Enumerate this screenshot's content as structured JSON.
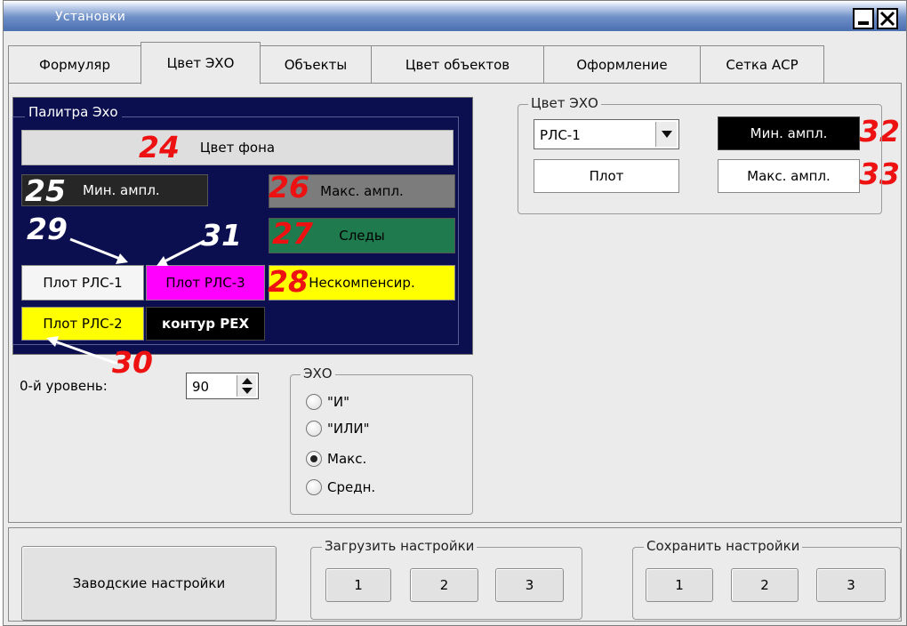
{
  "window": {
    "title": "Установки"
  },
  "tabs": [
    {
      "label": "Формуляр"
    },
    {
      "label": "Цвет ЭХО"
    },
    {
      "label": "Объекты"
    },
    {
      "label": "Цвет объектов"
    },
    {
      "label": "Оформление"
    },
    {
      "label": "Сетка АСР"
    }
  ],
  "palette": {
    "title": "Палитра Эхо",
    "background_label": "Цвет фона",
    "min_ampl_label": "Мин. ампл.",
    "max_ampl_label": "Макс. ампл.",
    "traces_label": "Следы",
    "uncompensated_label": "Нескомпенсир.",
    "plot_rls1_label": "Плот РЛС-1",
    "plot_rls3_label": "Плот РЛС-3",
    "plot_rls2_label": "Плот РЛС-2",
    "contour_label": "контур РЕХ",
    "colors": {
      "background": "#0b0e4f",
      "bg_button": "#dedede",
      "min_ampl": "#262626",
      "max_ampl": "#7c7c7c",
      "traces": "#1f7a4d",
      "uncompensated": "#ffff00",
      "plot_rls1": "#f5f5f5",
      "plot_rls3": "#ff00ff",
      "plot_rls2": "#ffff00",
      "contour": "#000000"
    }
  },
  "zero_level": {
    "label": "0-й уровень:",
    "value": "90"
  },
  "echo_mode": {
    "label": "ЭХО",
    "options": [
      {
        "label": "\"И\"",
        "checked": false
      },
      {
        "label": "\"ИЛИ\"",
        "checked": false
      },
      {
        "label": "Макс.",
        "checked": true
      },
      {
        "label": "Средн.",
        "checked": false
      }
    ]
  },
  "echo_color": {
    "label": "Цвет ЭХО",
    "radar_select": "РЛС-1",
    "min_ampl_label": "Мин. ампл.",
    "plot_label": "Плот",
    "max_ampl_label": "Макс. ампл."
  },
  "bottom": {
    "factory_label": "Заводские настройки",
    "load": {
      "label": "Загрузить настройки",
      "buttons": [
        "1",
        "2",
        "3"
      ]
    },
    "save": {
      "label": "Сохранить настройки",
      "buttons": [
        "1",
        "2",
        "3"
      ]
    }
  },
  "annotations": {
    "n24": "24",
    "n25": "25",
    "n26": "26",
    "n27": "27",
    "n28": "28",
    "n29": "29",
    "n30": "30",
    "n31": "31",
    "n32": "32",
    "n33": "33"
  }
}
